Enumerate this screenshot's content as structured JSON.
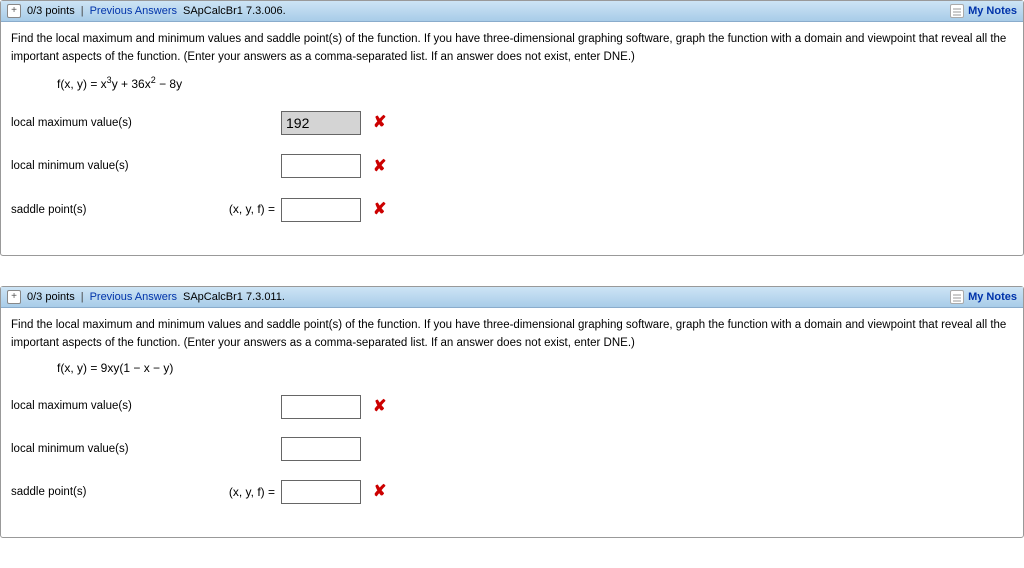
{
  "questions": [
    {
      "header": {
        "expand": "+",
        "points": "0/3 points",
        "prev": "Previous Answers",
        "code": "SApCalcBr1 7.3.006.",
        "notes": "My Notes"
      },
      "instructions": "Find the local maximum and minimum values and saddle point(s) of the function. If you have three-dimensional graphing software, graph the function with a domain and viewpoint that reveal all the important aspects of the function. (Enter your answers as a comma-separated list. If an answer does not exist, enter DNE.)",
      "formula_html": "f(x, y) = x<span class=\"sup\">3</span>y + 36x<span class=\"sup\">2</span> − 8y",
      "rows": [
        {
          "label": "local maximum value(s)",
          "prefix": "",
          "value": "192",
          "mark": "✘",
          "filled": true
        },
        {
          "label": "local minimum value(s)",
          "prefix": "",
          "value": "",
          "mark": "✘",
          "filled": false
        },
        {
          "label": "saddle point(s)",
          "prefix": "(x, y, f)  =",
          "value": "",
          "mark": "✘",
          "filled": false
        }
      ]
    },
    {
      "header": {
        "expand": "+",
        "points": "0/3 points",
        "prev": "Previous Answers",
        "code": "SApCalcBr1 7.3.011.",
        "notes": "My Notes"
      },
      "instructions": "Find the local maximum and minimum values and saddle point(s) of the function. If you have three-dimensional graphing software, graph the function with a domain and viewpoint that reveal all the important aspects of the function. (Enter your answers as a comma-separated list. If an answer does not exist, enter DNE.)",
      "formula_html": "f(x, y) = 9xy(1 − x − y)",
      "rows": [
        {
          "label": "local maximum value(s)",
          "prefix": "",
          "value": "",
          "mark": "✘",
          "filled": false
        },
        {
          "label": "local minimum value(s)",
          "prefix": "",
          "value": "",
          "mark": "",
          "filled": false
        },
        {
          "label": "saddle point(s)",
          "prefix": "(x, y, f)  =",
          "value": "",
          "mark": "✘",
          "filled": false
        }
      ]
    }
  ]
}
